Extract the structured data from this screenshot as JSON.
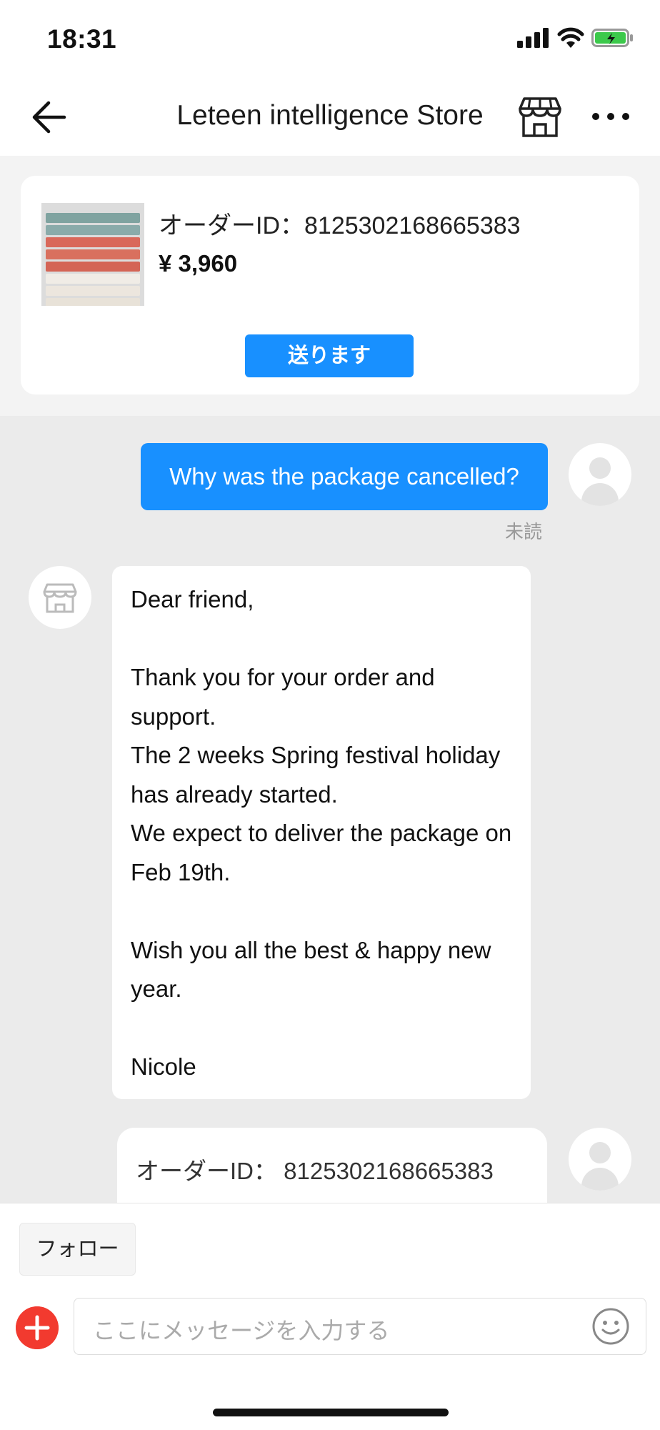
{
  "status_bar": {
    "time": "18:31"
  },
  "header": {
    "title": "Leteen intelligence Store"
  },
  "order_card": {
    "order_id": "オーダーID：8125302168665383",
    "price": "¥ 3,960",
    "send_label": "送ります"
  },
  "messages": {
    "outgoing_text": "Why was the package cancelled?",
    "unread_label": "未読",
    "incoming_text": "Dear friend,\n\nThank you for your order and support.\nThe 2 weeks Spring festival holiday has already started.\nWe expect to deliver the package on Feb 19th.\n\nWish you all the best & happy new year.\n\nNicole",
    "order_text": "オーダーID： 8125302168665383"
  },
  "footer": {
    "follow_label": "フォロー",
    "input_placeholder": "ここにメッセージを入力する"
  },
  "colors": {
    "accent": "#1890ff",
    "plus": "#f23a2f",
    "background": "#ebebeb"
  },
  "icons": [
    "back-arrow-icon",
    "store-icon",
    "more-icon",
    "signal-icon",
    "wifi-icon",
    "battery-icon",
    "plus-icon",
    "emoji-icon"
  ]
}
